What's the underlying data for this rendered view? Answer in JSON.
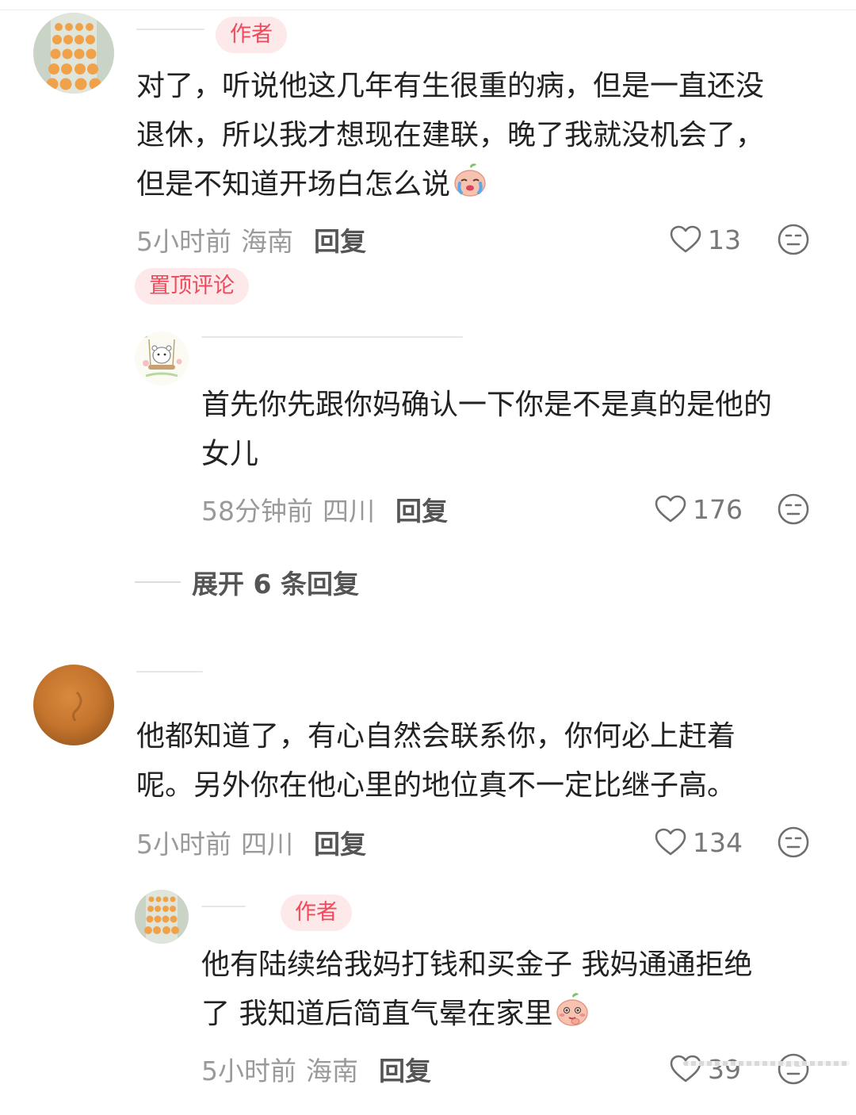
{
  "comments": [
    {
      "author_badge": "作者",
      "text_lines": [
        "对了，听说他这几年有生很重的病，但是一直还没",
        "退休，所以我才想现在建联，晚了我就没机会了，",
        "但是不知道开场白怎么说"
      ],
      "emoji": "crying-peach-emoji",
      "time": "5小时前",
      "location": "海南",
      "reply_label": "回复",
      "likes": "13",
      "pinned_label": "置顶评论",
      "replies": [
        {
          "text_lines": [
            "首先你先跟你妈确认一下你是不是真的是他的",
            "女儿"
          ],
          "time": "58分钟前",
          "location": "四川",
          "reply_label": "回复",
          "likes": "176"
        }
      ],
      "expand_label": "展开 6 条回复"
    },
    {
      "text_lines": [
        "他都知道了，有心自然会联系你，你何必上赶着",
        "呢。另外你在他心里的地位真不一定比继子高。"
      ],
      "time": "5小时前",
      "location": "四川",
      "reply_label": "回复",
      "likes": "134",
      "replies": [
        {
          "author_badge": "作者",
          "text_lines": [
            "他有陆续给我妈打钱和买金子 我妈通通拒绝",
            "了 我知道后简直气晕在家里"
          ],
          "emoji": "shy-peach-emoji",
          "time": "5小时前",
          "location": "海南",
          "reply_label": "回复",
          "likes": "39"
        }
      ]
    }
  ],
  "icons": {
    "like": "heart-outline-icon",
    "dislike": "neutral-face-icon"
  },
  "colors": {
    "badge_bg": "#fde8ea",
    "badge_text": "#ef4a5c",
    "meta_text": "#9a9a9a"
  }
}
